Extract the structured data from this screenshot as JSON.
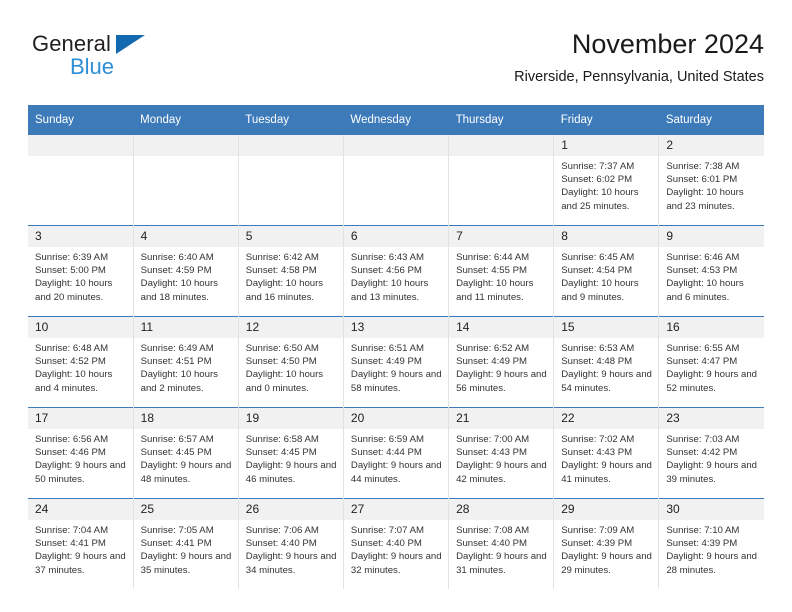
{
  "brand": {
    "name_top": "General",
    "name_bottom": "Blue",
    "triangle_icon": "blue-triangle-logo",
    "accent_color": "#1269b0",
    "accent_color_light": "#2e8fd6"
  },
  "header": {
    "title": "November 2024",
    "subtitle": "Riverside, Pennsylvania, United States"
  },
  "theme": {
    "header_blue": "#3c7ab9",
    "daynum_gray": "#f1f1f1",
    "text": "#333333"
  },
  "calendar": {
    "weekdays": [
      "Sunday",
      "Monday",
      "Tuesday",
      "Wednesday",
      "Thursday",
      "Friday",
      "Saturday"
    ],
    "labels": {
      "sunrise": "Sunrise:",
      "sunset": "Sunset:",
      "daylight": "Daylight:"
    },
    "weeks": [
      [
        {
          "day": ""
        },
        {
          "day": ""
        },
        {
          "day": ""
        },
        {
          "day": ""
        },
        {
          "day": ""
        },
        {
          "day": "1",
          "sunrise": "Sunrise: 7:37 AM",
          "sunset": "Sunset: 6:02 PM",
          "daylight": "Daylight: 10 hours and 25 minutes."
        },
        {
          "day": "2",
          "sunrise": "Sunrise: 7:38 AM",
          "sunset": "Sunset: 6:01 PM",
          "daylight": "Daylight: 10 hours and 23 minutes."
        }
      ],
      [
        {
          "day": "3",
          "sunrise": "Sunrise: 6:39 AM",
          "sunset": "Sunset: 5:00 PM",
          "daylight": "Daylight: 10 hours and 20 minutes."
        },
        {
          "day": "4",
          "sunrise": "Sunrise: 6:40 AM",
          "sunset": "Sunset: 4:59 PM",
          "daylight": "Daylight: 10 hours and 18 minutes."
        },
        {
          "day": "5",
          "sunrise": "Sunrise: 6:42 AM",
          "sunset": "Sunset: 4:58 PM",
          "daylight": "Daylight: 10 hours and 16 minutes."
        },
        {
          "day": "6",
          "sunrise": "Sunrise: 6:43 AM",
          "sunset": "Sunset: 4:56 PM",
          "daylight": "Daylight: 10 hours and 13 minutes."
        },
        {
          "day": "7",
          "sunrise": "Sunrise: 6:44 AM",
          "sunset": "Sunset: 4:55 PM",
          "daylight": "Daylight: 10 hours and 11 minutes."
        },
        {
          "day": "8",
          "sunrise": "Sunrise: 6:45 AM",
          "sunset": "Sunset: 4:54 PM",
          "daylight": "Daylight: 10 hours and 9 minutes."
        },
        {
          "day": "9",
          "sunrise": "Sunrise: 6:46 AM",
          "sunset": "Sunset: 4:53 PM",
          "daylight": "Daylight: 10 hours and 6 minutes."
        }
      ],
      [
        {
          "day": "10",
          "sunrise": "Sunrise: 6:48 AM",
          "sunset": "Sunset: 4:52 PM",
          "daylight": "Daylight: 10 hours and 4 minutes."
        },
        {
          "day": "11",
          "sunrise": "Sunrise: 6:49 AM",
          "sunset": "Sunset: 4:51 PM",
          "daylight": "Daylight: 10 hours and 2 minutes."
        },
        {
          "day": "12",
          "sunrise": "Sunrise: 6:50 AM",
          "sunset": "Sunset: 4:50 PM",
          "daylight": "Daylight: 10 hours and 0 minutes."
        },
        {
          "day": "13",
          "sunrise": "Sunrise: 6:51 AM",
          "sunset": "Sunset: 4:49 PM",
          "daylight": "Daylight: 9 hours and 58 minutes."
        },
        {
          "day": "14",
          "sunrise": "Sunrise: 6:52 AM",
          "sunset": "Sunset: 4:49 PM",
          "daylight": "Daylight: 9 hours and 56 minutes."
        },
        {
          "day": "15",
          "sunrise": "Sunrise: 6:53 AM",
          "sunset": "Sunset: 4:48 PM",
          "daylight": "Daylight: 9 hours and 54 minutes."
        },
        {
          "day": "16",
          "sunrise": "Sunrise: 6:55 AM",
          "sunset": "Sunset: 4:47 PM",
          "daylight": "Daylight: 9 hours and 52 minutes."
        }
      ],
      [
        {
          "day": "17",
          "sunrise": "Sunrise: 6:56 AM",
          "sunset": "Sunset: 4:46 PM",
          "daylight": "Daylight: 9 hours and 50 minutes."
        },
        {
          "day": "18",
          "sunrise": "Sunrise: 6:57 AM",
          "sunset": "Sunset: 4:45 PM",
          "daylight": "Daylight: 9 hours and 48 minutes."
        },
        {
          "day": "19",
          "sunrise": "Sunrise: 6:58 AM",
          "sunset": "Sunset: 4:45 PM",
          "daylight": "Daylight: 9 hours and 46 minutes."
        },
        {
          "day": "20",
          "sunrise": "Sunrise: 6:59 AM",
          "sunset": "Sunset: 4:44 PM",
          "daylight": "Daylight: 9 hours and 44 minutes."
        },
        {
          "day": "21",
          "sunrise": "Sunrise: 7:00 AM",
          "sunset": "Sunset: 4:43 PM",
          "daylight": "Daylight: 9 hours and 42 minutes."
        },
        {
          "day": "22",
          "sunrise": "Sunrise: 7:02 AM",
          "sunset": "Sunset: 4:43 PM",
          "daylight": "Daylight: 9 hours and 41 minutes."
        },
        {
          "day": "23",
          "sunrise": "Sunrise: 7:03 AM",
          "sunset": "Sunset: 4:42 PM",
          "daylight": "Daylight: 9 hours and 39 minutes."
        }
      ],
      [
        {
          "day": "24",
          "sunrise": "Sunrise: 7:04 AM",
          "sunset": "Sunset: 4:41 PM",
          "daylight": "Daylight: 9 hours and 37 minutes."
        },
        {
          "day": "25",
          "sunrise": "Sunrise: 7:05 AM",
          "sunset": "Sunset: 4:41 PM",
          "daylight": "Daylight: 9 hours and 35 minutes."
        },
        {
          "day": "26",
          "sunrise": "Sunrise: 7:06 AM",
          "sunset": "Sunset: 4:40 PM",
          "daylight": "Daylight: 9 hours and 34 minutes."
        },
        {
          "day": "27",
          "sunrise": "Sunrise: 7:07 AM",
          "sunset": "Sunset: 4:40 PM",
          "daylight": "Daylight: 9 hours and 32 minutes."
        },
        {
          "day": "28",
          "sunrise": "Sunrise: 7:08 AM",
          "sunset": "Sunset: 4:40 PM",
          "daylight": "Daylight: 9 hours and 31 minutes."
        },
        {
          "day": "29",
          "sunrise": "Sunrise: 7:09 AM",
          "sunset": "Sunset: 4:39 PM",
          "daylight": "Daylight: 9 hours and 29 minutes."
        },
        {
          "day": "30",
          "sunrise": "Sunrise: 7:10 AM",
          "sunset": "Sunset: 4:39 PM",
          "daylight": "Daylight: 9 hours and 28 minutes."
        }
      ]
    ]
  }
}
